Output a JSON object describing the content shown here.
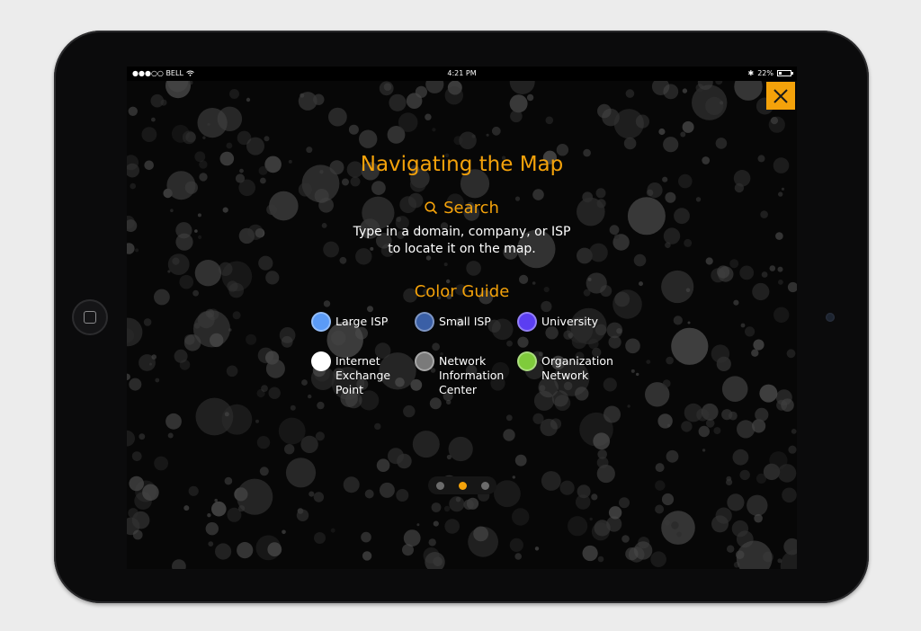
{
  "status_bar": {
    "carrier": "●●●○○ BELL",
    "time": "4:21 PM",
    "battery": "22%",
    "battery_level": 0.22
  },
  "overlay": {
    "title": "Navigating the Map",
    "search_heading": "Search",
    "search_description_line1": "Type in a domain, company, or ISP",
    "search_description_line2": "to locate it on the map.",
    "color_guide_title": "Color Guide",
    "legend": [
      {
        "label_lines": [
          "Large ISP"
        ],
        "color": "#5b9bf6"
      },
      {
        "label_lines": [
          "Small ISP"
        ],
        "color": "#3a5fa6"
      },
      {
        "label_lines": [
          "University"
        ],
        "color": "#5b3ef2"
      },
      {
        "label_lines": [
          "Internet",
          "Exchange",
          "Point"
        ],
        "color": "#ffffff"
      },
      {
        "label_lines": [
          "Network",
          "Information",
          "Center"
        ],
        "color": "#7a7a7a"
      },
      {
        "label_lines": [
          "Organization",
          "Network"
        ],
        "color": "#7fcb3b"
      }
    ],
    "pager": {
      "count": 3,
      "active_index": 1
    }
  },
  "colors": {
    "accent": "#f4a20a",
    "screen_bg": "#070707"
  }
}
